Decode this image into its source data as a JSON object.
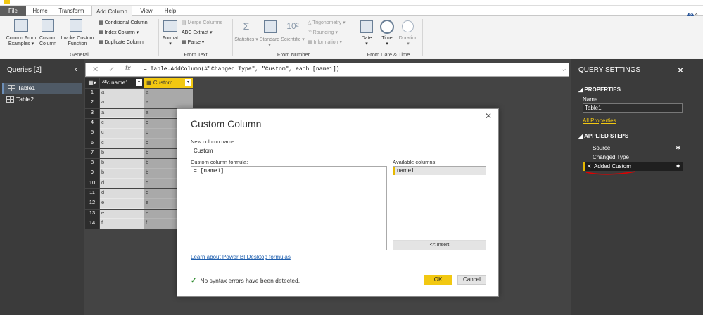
{
  "tabs": [
    "File",
    "Home",
    "Transform",
    "Add Column",
    "View",
    "Help"
  ],
  "ribbon": {
    "general": {
      "label": "General",
      "col_from_examples": "Column From",
      "col_from_examples2": "Examples",
      "custom_column": "Custom",
      "custom_column2": "Column",
      "invoke_custom": "Invoke Custom",
      "invoke_custom2": "Function",
      "conditional": "Conditional Column",
      "index": "Index Column",
      "duplicate": "Duplicate Column"
    },
    "from_text": {
      "label": "From Text",
      "format": "Format",
      "merge": "Merge Columns",
      "extract": "Extract",
      "parse": "Parse"
    },
    "from_number": {
      "label": "From Number",
      "statistics": "Statistics",
      "standard": "Standard",
      "scientific": "Scientific",
      "trigonometry": "Trigonometry",
      "rounding": "Rounding",
      "information": "Information"
    },
    "from_date": {
      "label": "From Date & Time",
      "date": "Date",
      "time": "Time",
      "duration": "Duration"
    }
  },
  "queries": {
    "title": "Queries [2]",
    "items": [
      "Table1",
      "Table2"
    ]
  },
  "formula_bar": {
    "formula": "= Table.AddColumn(#\"Changed Type\", \"Custom\", each [name1])"
  },
  "grid": {
    "col1": "name1",
    "col2": "Custom",
    "rows": [
      [
        "1",
        "a",
        "a"
      ],
      [
        "2",
        "a",
        "a"
      ],
      [
        "3",
        "a",
        "a"
      ],
      [
        "4",
        "c",
        "c"
      ],
      [
        "5",
        "c",
        "c"
      ],
      [
        "6",
        "c",
        "c"
      ],
      [
        "7",
        "b",
        "b"
      ],
      [
        "8",
        "b",
        "b"
      ],
      [
        "9",
        "b",
        "b"
      ],
      [
        "10",
        "d",
        "d"
      ],
      [
        "11",
        "d",
        "d"
      ],
      [
        "12",
        "e",
        "e"
      ],
      [
        "13",
        "e",
        "e"
      ],
      [
        "14",
        "f",
        "f"
      ]
    ]
  },
  "query_settings": {
    "title": "QUERY SETTINGS",
    "properties": "PROPERTIES",
    "name_label": "Name",
    "name_value": "Table1",
    "all_properties": "All Properties",
    "applied_steps": "APPLIED STEPS",
    "steps": [
      "Source",
      "Changed Type",
      "Added Custom"
    ]
  },
  "dialog": {
    "title": "Custom Column",
    "new_col_label": "New column name",
    "new_col_value": "Custom",
    "formula_label": "Custom column formula:",
    "formula_value": "= [name1]",
    "available_label": "Available columns:",
    "available": [
      "name1"
    ],
    "insert": "<< Insert",
    "link": "Learn about Power BI Desktop formulas",
    "status": "No syntax errors have been detected.",
    "ok": "OK",
    "cancel": "Cancel"
  },
  "colors": {
    "accent": "#f2c811",
    "dark_panel": "#3b3b3b",
    "annotation": "#e00000"
  }
}
